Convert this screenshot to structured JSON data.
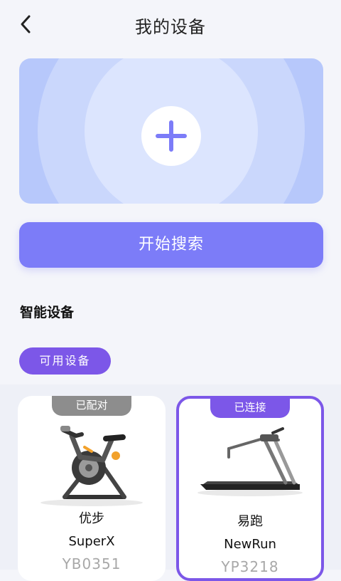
{
  "header": {
    "title": "我的设备",
    "back_icon": "chevron-left-icon"
  },
  "banner": {
    "add_icon": "plus-icon",
    "colors": {
      "outer": "#b7c8fb",
      "middle": "#cad7fc",
      "inner": "#dce5fe",
      "plus": "#7c7cf8"
    }
  },
  "search_button": {
    "label": "开始搜索",
    "color": "#7c7cf8"
  },
  "section": {
    "title": "智能设备",
    "tab_label": "可用设备"
  },
  "devices": [
    {
      "status": "已配对",
      "brand": "优步",
      "model": "SuperX",
      "serial": "YB0351",
      "icon": "exercise-bike-image",
      "status_color": "#8d8d8d"
    },
    {
      "status": "已连接",
      "brand": "易跑",
      "model": "NewRun",
      "serial": "YP3218",
      "icon": "treadmill-image",
      "status_color": "#7c57e8"
    }
  ]
}
